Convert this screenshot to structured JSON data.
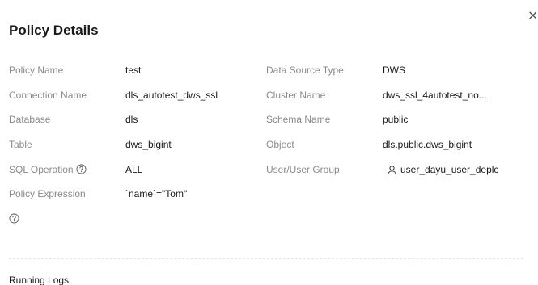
{
  "dialog": {
    "title": "Policy Details",
    "close_icon": "close-icon"
  },
  "details": {
    "policy_name": {
      "label": "Policy Name",
      "value": "test"
    },
    "data_source_type": {
      "label": "Data Source Type",
      "value": "DWS"
    },
    "connection_name": {
      "label": "Connection Name",
      "value": "dls_autotest_dws_ssl"
    },
    "cluster_name": {
      "label": "Cluster Name",
      "value": "dws_ssl_4autotest_no..."
    },
    "database": {
      "label": "Database",
      "value": "dls"
    },
    "schema_name": {
      "label": "Schema Name",
      "value": "public"
    },
    "table": {
      "label": "Table",
      "value": "dws_bigint"
    },
    "object": {
      "label": "Object",
      "value": "dls.public.dws_bigint"
    },
    "sql_operation": {
      "label": "SQL Operation",
      "value": "ALL",
      "icon": "help-icon"
    },
    "user_group": {
      "label": "User/User Group",
      "value": "user_dayu_user_deplc",
      "icon": "user-icon"
    },
    "policy_expression": {
      "label": "Policy Expression",
      "value": "`name`=\"Tom\"",
      "icon": "help-icon"
    }
  },
  "running_logs": {
    "title": "Running Logs"
  }
}
